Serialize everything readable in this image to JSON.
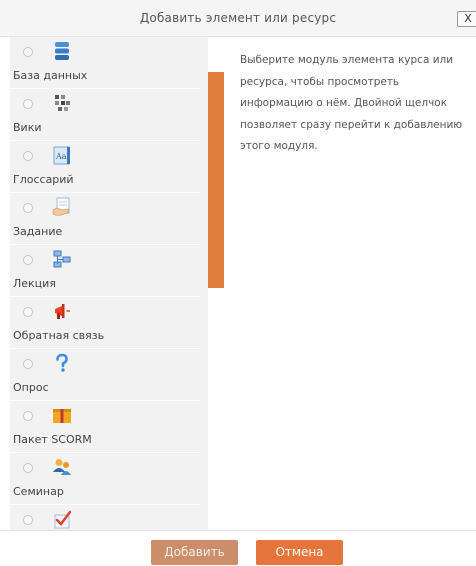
{
  "dialog": {
    "title": "Добавить элемент или ресурс",
    "close_label": "X"
  },
  "modules": [
    {
      "label": "База данных",
      "icon": "database-icon"
    },
    {
      "label": "Вики",
      "icon": "wiki-icon"
    },
    {
      "label": "Глоссарий",
      "icon": "glossary-icon"
    },
    {
      "label": "Задание",
      "icon": "assignment-icon"
    },
    {
      "label": "Лекция",
      "icon": "lesson-icon"
    },
    {
      "label": "Обратная связь",
      "icon": "feedback-megaphone-icon"
    },
    {
      "label": "Опрос",
      "icon": "question-icon"
    },
    {
      "label": "Пакет SCORM",
      "icon": "scorm-package-icon"
    },
    {
      "label": "Семинар",
      "icon": "workshop-icon"
    },
    {
      "label": "",
      "icon": "quiz-check-icon"
    }
  ],
  "info": {
    "text": "Выберите модуль элемента курса или ресурса, чтобы просмотреть информацию о нём. Двойной щелчок позволяет сразу перейти к добавлению этого модуля."
  },
  "footer": {
    "add_label": "Добавить",
    "cancel_label": "Отмена"
  },
  "colors": {
    "accent": "#e5753a",
    "accent_disabled": "#cc8d6a",
    "panel_bg": "#f2f2f2"
  }
}
